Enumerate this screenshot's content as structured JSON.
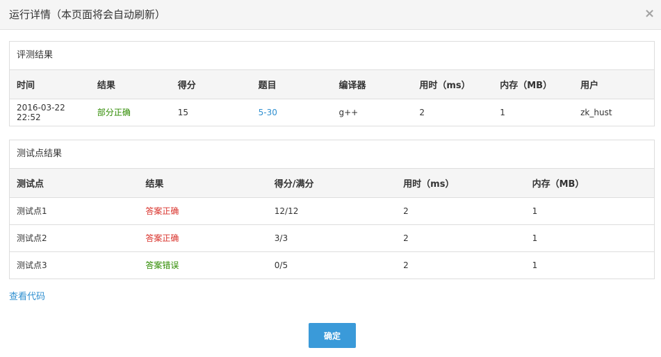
{
  "dialog": {
    "title": "运行详情（本页面将会自动刷新）",
    "close_glyph": "×"
  },
  "evaluation": {
    "heading": "评测结果",
    "columns": [
      "时间",
      "结果",
      "得分",
      "题目",
      "编译器",
      "用时（ms）",
      "内存（MB）",
      "用户"
    ],
    "row": {
      "time": "2016-03-22 22:52",
      "result": "部分正确",
      "score": "15",
      "problem": "5-30",
      "compiler": "g++",
      "time_ms": "2",
      "memory_mb": "1",
      "user": "zk_hust"
    }
  },
  "testcases": {
    "heading": "测试点结果",
    "columns": [
      "测试点",
      "结果",
      "得分/满分",
      "用时（ms）",
      "内存（MB）"
    ],
    "rows": [
      {
        "name": "测试点1",
        "result": "答案正确",
        "status": "correct",
        "score": "12/12",
        "time_ms": "2",
        "memory_mb": "1"
      },
      {
        "name": "测试点2",
        "result": "答案正确",
        "status": "correct",
        "score": "3/3",
        "time_ms": "2",
        "memory_mb": "1"
      },
      {
        "name": "测试点3",
        "result": "答案错误",
        "status": "wrong",
        "score": "0/5",
        "time_ms": "2",
        "memory_mb": "1"
      }
    ]
  },
  "actions": {
    "view_code": "查看代码",
    "confirm": "确定"
  },
  "colors": {
    "partial_correct": "#2e8b00",
    "correct": "#d9312a",
    "wrong": "#2e8b00",
    "link": "#2f8fd0",
    "primary_button": "#3a9ad9"
  }
}
